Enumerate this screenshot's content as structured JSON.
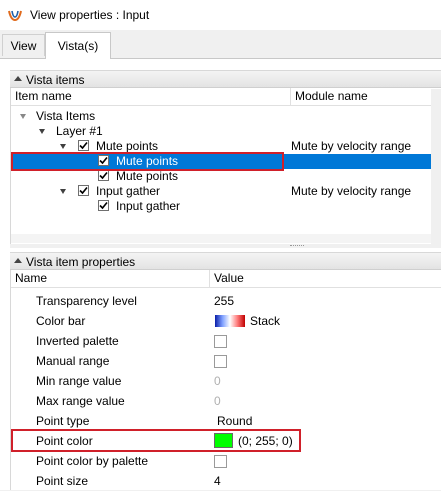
{
  "window": {
    "title": "View properties : Input"
  },
  "tabs": [
    {
      "label": "View",
      "active": false
    },
    {
      "label": "Vista(s)",
      "active": true
    }
  ],
  "vista_items": {
    "header": "Vista items",
    "columns": [
      "Item name",
      "Module name"
    ],
    "tree": [
      {
        "label": "Vista Items",
        "module": "",
        "checked": null,
        "expanded": false,
        "selected": false
      },
      {
        "label": "Layer  #1",
        "module": "",
        "checked": null,
        "expanded": true,
        "selected": false
      },
      {
        "label": "Mute points",
        "module": "Mute by velocity range",
        "checked": true,
        "expanded": true,
        "selected": false
      },
      {
        "label": "Mute points",
        "module": "",
        "checked": true,
        "expanded": false,
        "selected": true
      },
      {
        "label": "Mute points",
        "module": "",
        "checked": true,
        "expanded": false,
        "selected": false
      },
      {
        "label": "Input gather",
        "module": "Mute by velocity range",
        "checked": true,
        "expanded": true,
        "selected": false
      },
      {
        "label": "Input gather",
        "module": "",
        "checked": true,
        "expanded": false,
        "selected": false
      }
    ]
  },
  "properties": {
    "header": "Vista item properties",
    "columns": [
      "Name",
      "Value"
    ],
    "rows": [
      {
        "name": "Transparency level",
        "value": "255"
      },
      {
        "name": "Color bar",
        "value": "Stack"
      },
      {
        "name": "Inverted palette",
        "value": ""
      },
      {
        "name": "Manual range",
        "value": ""
      },
      {
        "name": "Min range value",
        "value": "0"
      },
      {
        "name": "Max range value",
        "value": "0"
      },
      {
        "name": "Point type",
        "value": "Round"
      },
      {
        "name": "Point color",
        "value": "(0; 255; 0)"
      },
      {
        "name": "Point color by palette",
        "value": ""
      },
      {
        "name": "Point size",
        "value": "4"
      }
    ]
  },
  "colors": {
    "selection": "#0078d7",
    "highlight_box": "#d0202a",
    "point_color": "#00ff00"
  }
}
